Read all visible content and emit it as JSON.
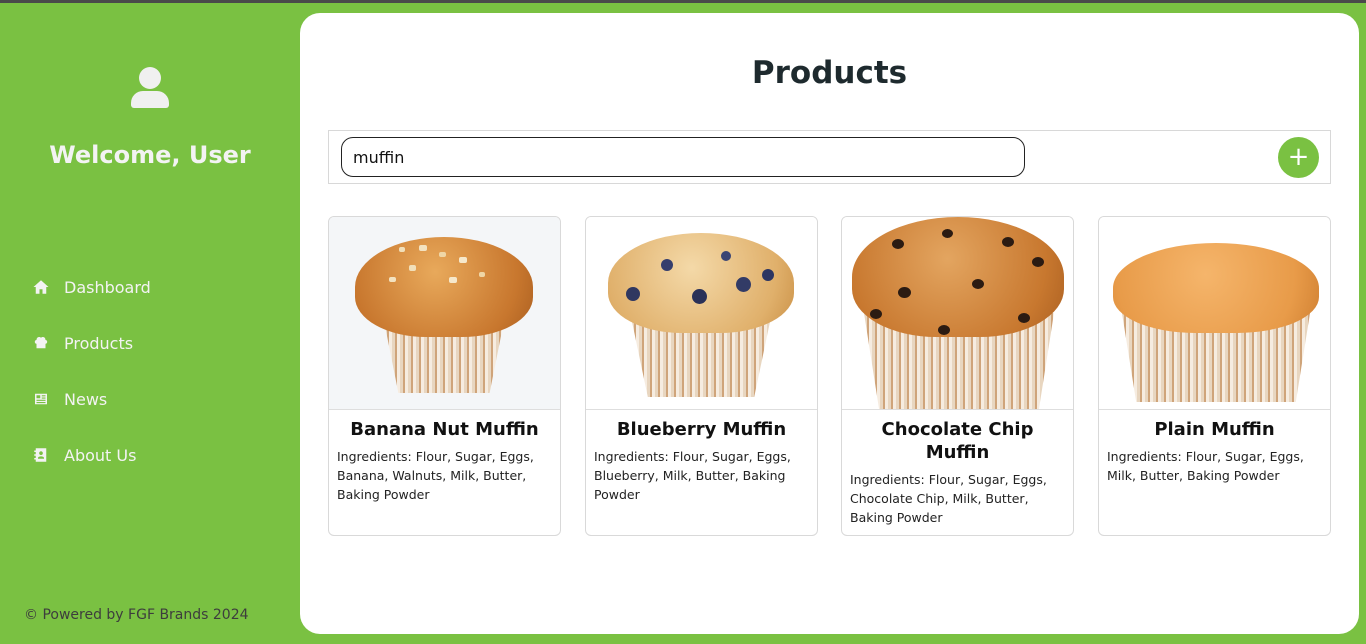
{
  "sidebar": {
    "welcome": "Welcome, User",
    "items": [
      {
        "label": "Dashboard",
        "icon": "home-icon"
      },
      {
        "label": "Products",
        "icon": "chef-hat-icon"
      },
      {
        "label": "News",
        "icon": "newspaper-icon"
      },
      {
        "label": "About Us",
        "icon": "contact-book-icon"
      }
    ],
    "footer": "© Powered by FGF Brands 2024"
  },
  "main": {
    "title": "Products",
    "search": {
      "value": "muffin",
      "placeholder": ""
    },
    "add_label": "+"
  },
  "products": [
    {
      "name": "Banana Nut Muffin",
      "ingredients": "Ingredients: Flour, Sugar, Eggs, Banana, Walnuts, Milk, Butter, Baking Powder"
    },
    {
      "name": "Blueberry Muffin",
      "ingredients": "Ingredients: Flour, Sugar, Eggs, Blueberry, Milk, Butter, Baking Powder"
    },
    {
      "name": "Chocolate Chip Muffin",
      "ingredients": "Ingredients: Flour, Sugar, Eggs, Chocolate Chip, Milk, Butter, Baking Powder"
    },
    {
      "name": "Plain Muffin",
      "ingredients": "Ingredients: Flour, Sugar, Eggs, Milk, Butter, Baking Powder"
    }
  ],
  "colors": {
    "accent": "#7ac142",
    "panel": "#ffffff",
    "text": "#1e2a2e"
  }
}
